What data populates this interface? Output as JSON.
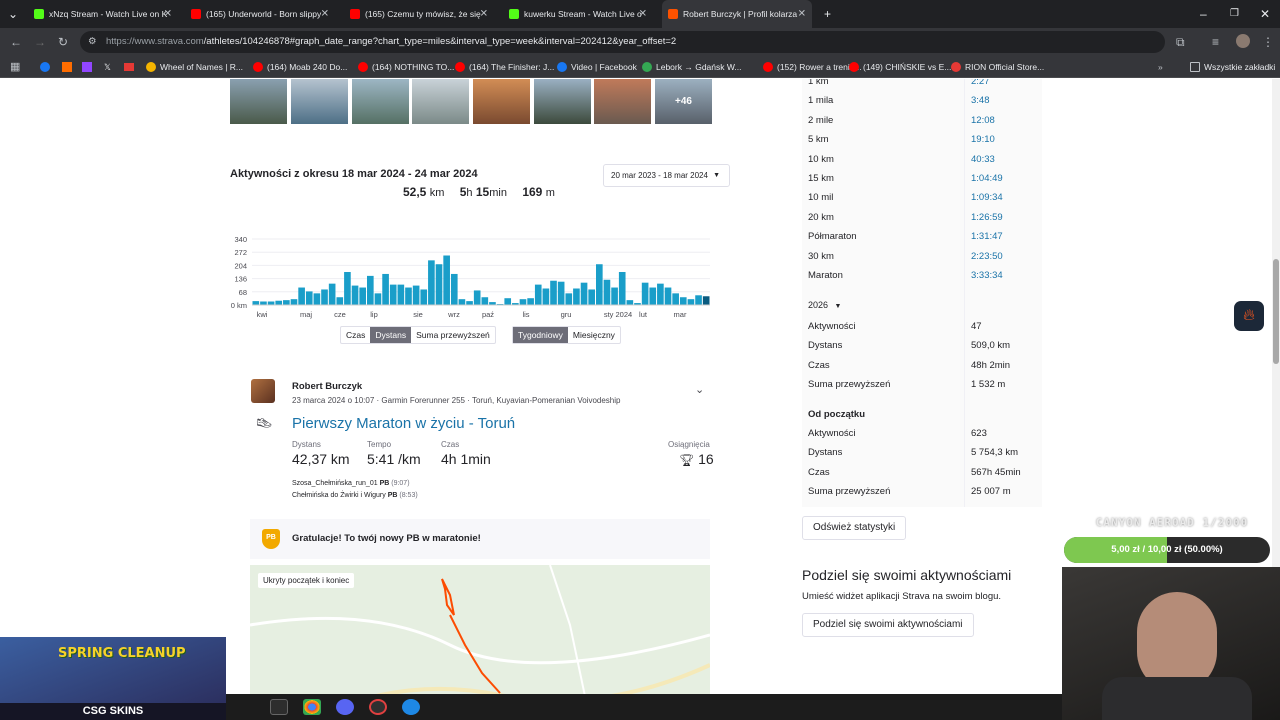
{
  "browser": {
    "tabs": [
      {
        "label": "xNzq Stream - Watch Live on K",
        "color": "#53fc18"
      },
      {
        "label": "(165) Underworld - Born slippy",
        "color": "#ff0000"
      },
      {
        "label": "(165) Czemu ty mówisz, że się",
        "color": "#ff0000"
      },
      {
        "label": "kuwerku Stream - Watch Live o",
        "color": "#53fc18"
      },
      {
        "label": "Robert Burczyk | Profil kolarza",
        "color": "#fc5200"
      }
    ],
    "url_host": "https://www.strava.com",
    "url_path": "/athletes/104246878#graph_date_range?chart_type=miles&interval_type=week&interval=202412&year_offset=2",
    "bookmarks": [
      {
        "label": "Wheel of Names | R...",
        "color": "#f4b400"
      },
      {
        "label": "(164) Moab 240 Do...",
        "color": "#ff0000"
      },
      {
        "label": "(164) NOTHING TO...",
        "color": "#ff0000"
      },
      {
        "label": "(164) The Finisher: J...",
        "color": "#ff0000"
      },
      {
        "label": "Video | Facebook",
        "color": "#1877f2"
      },
      {
        "label": "Lebork → Gdańsk W...",
        "color": "#34a853"
      },
      {
        "label": "(152) Rower a trenin...",
        "color": "#ff0000"
      },
      {
        "label": "(149) CHIŃSKIE vs E...",
        "color": "#ff0000"
      },
      {
        "label": "RION Official Store...",
        "color": "#e53935"
      }
    ],
    "all_bookmarks": "Wszystkie zakładki"
  },
  "photos": {
    "more": "+46"
  },
  "activity_summary": {
    "title": "Aktywności z okresu 18 mar 2024 - 24 mar 2024",
    "range_select": "20 mar 2023 - 18 mar 2024",
    "distance_val": "52,5",
    "distance_unit": "km",
    "time_h": "5",
    "time_h_unit": "h",
    "time_m": "15",
    "time_m_unit": "min",
    "elev_val": "169",
    "elev_unit": "m"
  },
  "chart_data": {
    "type": "bar",
    "ylabel": "",
    "y_ticks": [
      "340",
      "272",
      "204",
      "136",
      "68",
      "0 km"
    ],
    "ylim": [
      0,
      340
    ],
    "x_ticks": [
      "kwi",
      "maj",
      "cze",
      "lip",
      "sie",
      "wrz",
      "paź",
      "lis",
      "gru",
      "sty 2024",
      "lut",
      "mar"
    ],
    "values": [
      20,
      18,
      18,
      22,
      25,
      30,
      90,
      70,
      60,
      80,
      110,
      40,
      170,
      100,
      90,
      150,
      60,
      160,
      105,
      105,
      90,
      100,
      80,
      230,
      210,
      255,
      160,
      30,
      20,
      75,
      40,
      15,
      5,
      35,
      10,
      30,
      35,
      105,
      85,
      125,
      120,
      60,
      85,
      115,
      80,
      210,
      130,
      90,
      170,
      25,
      10,
      115,
      90,
      110,
      90,
      60,
      40,
      30,
      50,
      45
    ],
    "highlight_color": "#0a5b80",
    "bar_color": "#1a9ec9"
  },
  "chart_toggles": {
    "metric": [
      "Czas",
      "Dystans",
      "Suma przewyższeń"
    ],
    "metric_active": "Dystans",
    "interval": [
      "Tygodniowy",
      "Miesięczny"
    ],
    "interval_active": "Tygodniowy"
  },
  "feed": {
    "athlete": "Robert Burczyk",
    "meta": "23 marca 2024 o 10:07 · Garmin Forerunner 255 · Toruń, Kuyavian-Pomeranian Voivodeship",
    "title": "Pierwszy Maraton w życiu - Toruń",
    "stats": [
      {
        "label": "Dystans",
        "value": "42,37 km"
      },
      {
        "label": "Tempo",
        "value": "5:41 /km"
      },
      {
        "label": "Czas",
        "value": "4h 1min"
      }
    ],
    "achievements_label": "Osiągnięcia",
    "achievements_value": "16",
    "segments": [
      {
        "name": "Szosa_Chełmińska_run_01",
        "badge": "PB",
        "time": "(9:07)"
      },
      {
        "name": "Chełmińska do Żwirki i Wigury",
        "badge": "PB",
        "time": "(8:53)"
      }
    ],
    "pb_note": "Gratulacje! To twój nowy PB w maratonie!",
    "pb_badge": "PB",
    "map_label": "Ukryty początek i koniec"
  },
  "best_efforts": [
    {
      "k": "1 km",
      "v": "2:27"
    },
    {
      "k": "1 mila",
      "v": "3:48"
    },
    {
      "k": "2 mile",
      "v": "12:08"
    },
    {
      "k": "5 km",
      "v": "19:10"
    },
    {
      "k": "10 km",
      "v": "40:33"
    },
    {
      "k": "15 km",
      "v": "1:04:49"
    },
    {
      "k": "10 mil",
      "v": "1:09:34"
    },
    {
      "k": "20 km",
      "v": "1:26:59"
    },
    {
      "k": "Półmaraton",
      "v": "1:31:47"
    },
    {
      "k": "30 km",
      "v": "2:23:50"
    },
    {
      "k": "Maraton",
      "v": "3:33:34"
    }
  ],
  "year_stats": {
    "year": "2026",
    "rows": [
      {
        "k": "Aktywności",
        "v": "47"
      },
      {
        "k": "Dystans",
        "v": "509,0 km"
      },
      {
        "k": "Czas",
        "v": "48h 2min"
      },
      {
        "k": "Suma przewyższeń",
        "v": "1 532 m"
      }
    ]
  },
  "all_time": {
    "title": "Od początku",
    "rows": [
      {
        "k": "Aktywności",
        "v": "623"
      },
      {
        "k": "Dystans",
        "v": "5 754,3 km"
      },
      {
        "k": "Czas",
        "v": "567h 45min"
      },
      {
        "k": "Suma przewyższeń",
        "v": "25 007 m"
      }
    ]
  },
  "refresh_button": "Odśwież statystyki",
  "share": {
    "title": "Podziel się swoimi aktywnościami",
    "desc": "Umieść widżet aplikacji Strava na swoim blogu.",
    "button": "Podziel się swoimi aktywnościami"
  },
  "overlay": {
    "goal_title": "CANYON AEROAD 1/2000",
    "goal_progress": "5,00 zł / 10,00 zł (50.00%)",
    "goal_fraction": 0.5,
    "promo_title": "SPRING CLEANUP",
    "promo_brand": "CSG SKINS"
  }
}
